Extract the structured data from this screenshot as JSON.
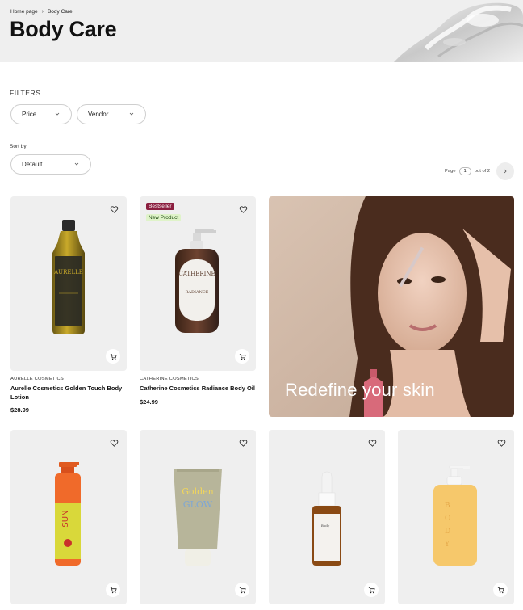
{
  "breadcrumb": {
    "home": "Home page",
    "separator": "›",
    "current": "Body Care"
  },
  "page_title": "Body Care",
  "filters": {
    "heading": "FILTERS",
    "price_label": "Price",
    "vendor_label": "Vendor"
  },
  "sort": {
    "label": "Sort by:",
    "value": "Default"
  },
  "pagination": {
    "page_label": "Page",
    "current": "1",
    "out_of": "out of 2"
  },
  "products": [
    {
      "vendor": "AURELLE COSMETICS",
      "name": "Aurelle Cosmetics Golden Touch Body Lotion",
      "price": "$28.99",
      "badges": []
    },
    {
      "vendor": "CATHERINE COSMETICS",
      "name": "Catherine Cosmetics Radiance Body Oil",
      "price": "$24.99",
      "badges": [
        "Bestseller",
        "New Product"
      ]
    },
    {
      "vendor": "",
      "name": "",
      "price": "",
      "badges": []
    },
    {
      "vendor": "",
      "name": "",
      "price": "",
      "badges": []
    },
    {
      "vendor": "",
      "name": "",
      "price": "",
      "badges": []
    },
    {
      "vendor": "",
      "name": "",
      "price": "",
      "badges": []
    }
  ],
  "promo": {
    "text": "Redefine your skin"
  },
  "colors": {
    "badge_bestseller": "#8b1e3f",
    "badge_new": "#dff3c9",
    "hero_bg": "#efefef",
    "card_bg": "#efefef"
  },
  "icons": {
    "favorite": "heart-icon",
    "cart": "cart-icon",
    "next": "chevron-right-icon",
    "dropdown": "chevron-down-icon"
  }
}
